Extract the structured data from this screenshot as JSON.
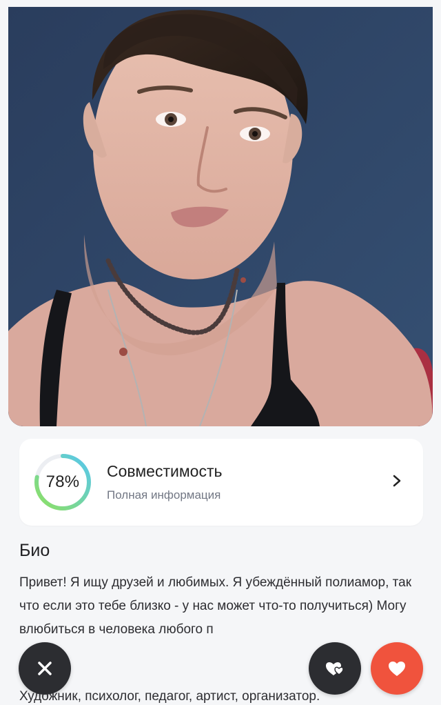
{
  "profile_photo": {
    "alt": "profile-photo"
  },
  "compatibility": {
    "percent_label": "78%",
    "percent_value": 78,
    "title": "Совместимость",
    "subtitle": "Полная информация"
  },
  "bio": {
    "title": "Био",
    "text": "Привет! Я ищу друзей и любимых. Я убеждённый полиамор, так что если это тебе близко - у нас может что-то получиться) Могу влюбиться в человека любого п",
    "text2": "Художник, психолог, педагог, артист, организатор."
  },
  "actions": {
    "dislike": "close-icon",
    "superlike": "double-heart-icon",
    "like": "heart-icon"
  },
  "colors": {
    "like": "#f0533d",
    "dark_button": "#2c2d31",
    "gauge_start": "#8fe15f",
    "gauge_end": "#56c7f0"
  }
}
